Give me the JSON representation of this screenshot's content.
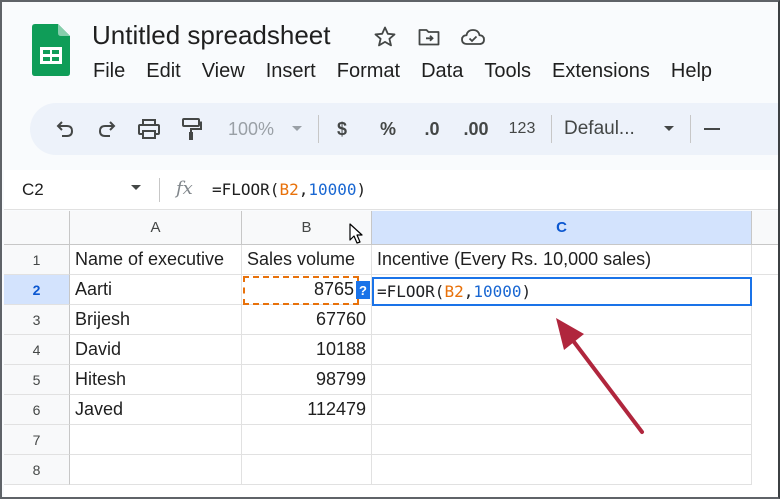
{
  "app": {
    "title": "Untitled spreadsheet",
    "brand_color": "#0f9d58"
  },
  "title_icons": [
    {
      "name": "star-icon",
      "glyph": "☆"
    },
    {
      "name": "move-folder-icon",
      "glyph": "folder"
    },
    {
      "name": "cloud-saved-icon",
      "glyph": "cloud"
    }
  ],
  "menu": [
    "File",
    "Edit",
    "View",
    "Insert",
    "Format",
    "Data",
    "Tools",
    "Extensions",
    "Help"
  ],
  "toolbar": {
    "zoom": "100%",
    "currency": "$",
    "percent": "%",
    "decrease_decimal": ".0",
    "increase_decimal": ".00",
    "number_format": "123",
    "font": "Defaul..."
  },
  "formula_bar": {
    "name_box": "C2",
    "fx": "fx",
    "formula_prefix": "=FLOOR(",
    "formula_ref": "B2",
    "formula_sep": ",",
    "formula_num": "10000",
    "formula_suffix": ")"
  },
  "grid": {
    "columns": [
      "A",
      "B",
      "C"
    ],
    "rows": [
      "1",
      "2",
      "3",
      "4",
      "5",
      "6",
      "7",
      "8"
    ],
    "headers": [
      "Name of executive",
      "Sales volume",
      "Incentive (Every Rs. 10,000 sales)"
    ],
    "data": [
      {
        "name": "Aarti",
        "sales": "8765"
      },
      {
        "name": "Brijesh",
        "sales": "67760"
      },
      {
        "name": "David",
        "sales": "10188"
      },
      {
        "name": "Hitesh",
        "sales": "98799"
      },
      {
        "name": "Javed",
        "sales": "112479"
      }
    ],
    "help_marker": "?"
  },
  "colors": {
    "selection": "#1a73e8",
    "reference": "#e8710a",
    "arrow": "#b0263d"
  }
}
